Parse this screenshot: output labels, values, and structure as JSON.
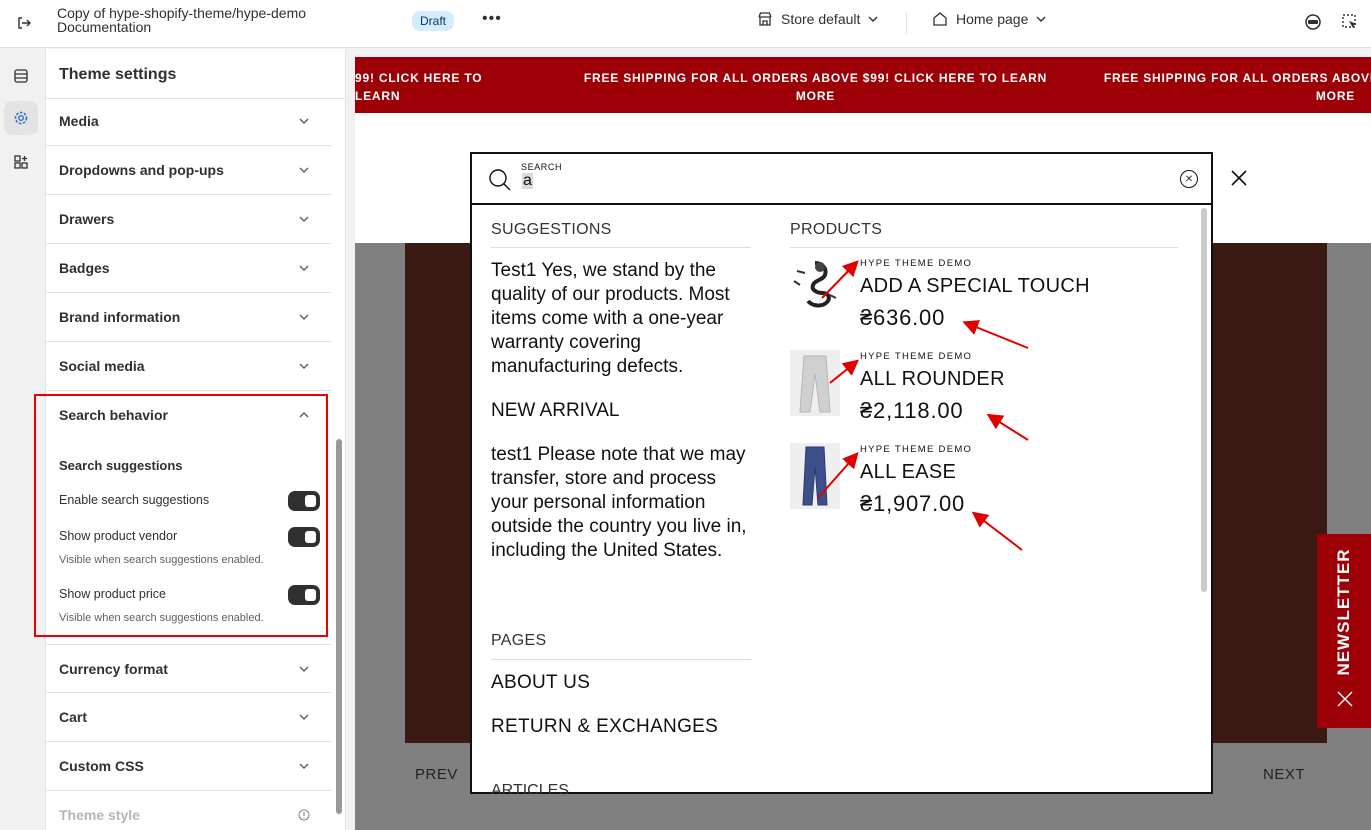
{
  "topbar": {
    "title_line1": "Copy of hype-shopify-theme/hype-demo",
    "title_line2": "Documentation",
    "status_badge": "Draft",
    "more_label": "•••",
    "store_select": "Store default",
    "page_select": "Home page"
  },
  "sidebar": {
    "title": "Theme settings",
    "sections_top": [
      "Media",
      "Dropdowns and pop-ups",
      "Drawers",
      "Badges",
      "Brand information",
      "Social media"
    ],
    "search_behavior": {
      "label": "Search behavior",
      "sub_heading": "Search suggestions",
      "toggles": [
        {
          "label": "Enable search suggestions",
          "help": "",
          "on": true
        },
        {
          "label": "Show product vendor",
          "help": "Visible when search suggestions enabled.",
          "on": true
        },
        {
          "label": "Show product price",
          "help": "Visible when search suggestions enabled.",
          "on": true
        }
      ]
    },
    "sections_bottom": [
      "Currency format",
      "Cart",
      "Custom CSS",
      "Theme style"
    ]
  },
  "preview": {
    "announcement": "FREE SHIPPING FOR ALL ORDERS ABOVE $99! CLICK HERE TO LEARN MORE",
    "announcement_left_fragment": "99! CLICK HERE TO LEARN",
    "prev_label": "PREV",
    "next_label": "NEXT",
    "newsletter_label": "NEWSLETTER"
  },
  "search": {
    "field_label": "SEARCH",
    "query": "a",
    "suggestions_heading": "SUGGESTIONS",
    "suggestions": [
      "Test1 Yes, we stand by the quality of our products. Most items come with a one-year warranty covering manufacturing defects.",
      "NEW ARRIVAL",
      "test1 Please note that we may transfer, store and process your personal information outside the country you live in, including the United States."
    ],
    "pages_heading": "PAGES",
    "pages": [
      "ABOUT US",
      "RETURN & EXCHANGES"
    ],
    "articles_heading": "ARTICLES",
    "products_heading": "PRODUCTS",
    "products": [
      {
        "vendor": "HYPE THEME DEMO",
        "title": "ADD A SPECIAL TOUCH",
        "price": "₴636.00"
      },
      {
        "vendor": "HYPE THEME DEMO",
        "title": "ALL ROUNDER",
        "price": "₴2,118.00"
      },
      {
        "vendor": "HYPE THEME DEMO",
        "title": "ALL EASE",
        "price": "₴1,907.00"
      }
    ]
  },
  "colors": {
    "announcement_bg": "#9c0006",
    "annotation": "#e00000",
    "toggle_on": "#303030",
    "badge_bg": "#d5ebff"
  }
}
